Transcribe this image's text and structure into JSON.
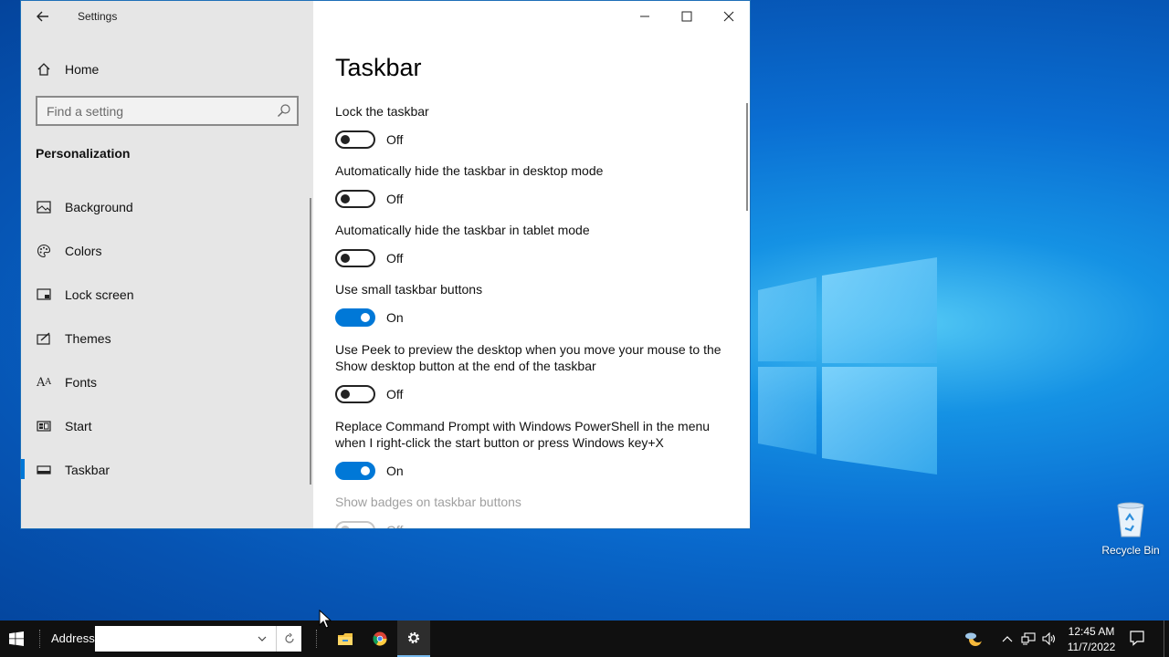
{
  "window": {
    "title": "Settings",
    "controls": {
      "minimize": "minimize",
      "maximize": "maximize",
      "close": "close"
    }
  },
  "sidebar": {
    "home": "Home",
    "search_placeholder": "Find a setting",
    "section": "Personalization",
    "items": [
      {
        "label": "Background",
        "icon": "picture-icon"
      },
      {
        "label": "Colors",
        "icon": "palette-icon"
      },
      {
        "label": "Lock screen",
        "icon": "lock-screen-icon"
      },
      {
        "label": "Themes",
        "icon": "themes-icon"
      },
      {
        "label": "Fonts",
        "icon": "fonts-icon"
      },
      {
        "label": "Start",
        "icon": "start-icon"
      },
      {
        "label": "Taskbar",
        "icon": "taskbar-icon",
        "selected": true
      }
    ]
  },
  "main": {
    "page_title": "Taskbar",
    "settings": [
      {
        "label": "Lock the taskbar",
        "state": "Off"
      },
      {
        "label": "Automatically hide the taskbar in desktop mode",
        "state": "Off"
      },
      {
        "label": "Automatically hide the taskbar in tablet mode",
        "state": "Off"
      },
      {
        "label": "Use small taskbar buttons",
        "state": "On"
      },
      {
        "label": "Use Peek to preview the desktop when you move your mouse to the Show desktop button at the end of the taskbar",
        "state": "Off"
      },
      {
        "label": "Replace Command Prompt with Windows PowerShell in the menu when I right-click the start button or press Windows key+X",
        "state": "On"
      },
      {
        "label": "Show badges on taskbar buttons",
        "state": "Off",
        "disabled": true
      }
    ]
  },
  "desktop": {
    "recycle_bin": "Recycle Bin"
  },
  "taskbar": {
    "address_label": "Address",
    "address_value": "",
    "clock_time": "12:45 AM",
    "clock_date": "11/7/2022"
  },
  "colors": {
    "accent": "#0078d7",
    "taskbar": "#101010",
    "sidebar": "#e6e6e6"
  }
}
